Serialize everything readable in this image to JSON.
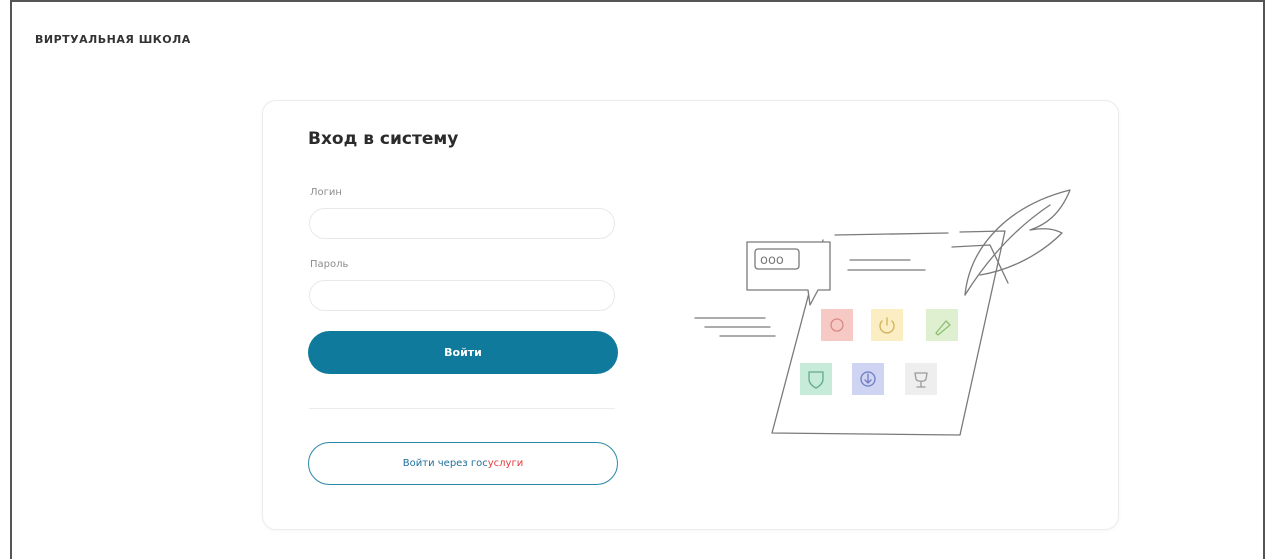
{
  "header": {
    "brand": "ВИРТУАЛЬНАЯ ШКОЛА"
  },
  "form": {
    "title": "Вход в систему",
    "login_label": "Логин",
    "login_value": "",
    "login_placeholder": "",
    "password_label": "Пароль",
    "password_value": "",
    "password_placeholder": "",
    "submit_label": "Войти",
    "gosuslugi_prefix": "Войти через гос",
    "gosuslugi_suffix": "услуги"
  },
  "illustration": {
    "chat_bubble_text": "ooo",
    "icons": [
      "target-icon",
      "power-icon",
      "pin-icon",
      "shield-icon",
      "download-icon",
      "trophy-icon"
    ]
  },
  "colors": {
    "primary": "#107a9c",
    "gosuslugi_blue": "#1f6f9c",
    "gosuslugi_red": "#e03d3d",
    "tile_red": "#f7c9c5",
    "tile_yellow": "#faeec2",
    "tile_green": "#def0cf",
    "tile_mint": "#c6ebd9",
    "tile_violet": "#cfd4f2",
    "tile_gray": "#eeeeee"
  }
}
